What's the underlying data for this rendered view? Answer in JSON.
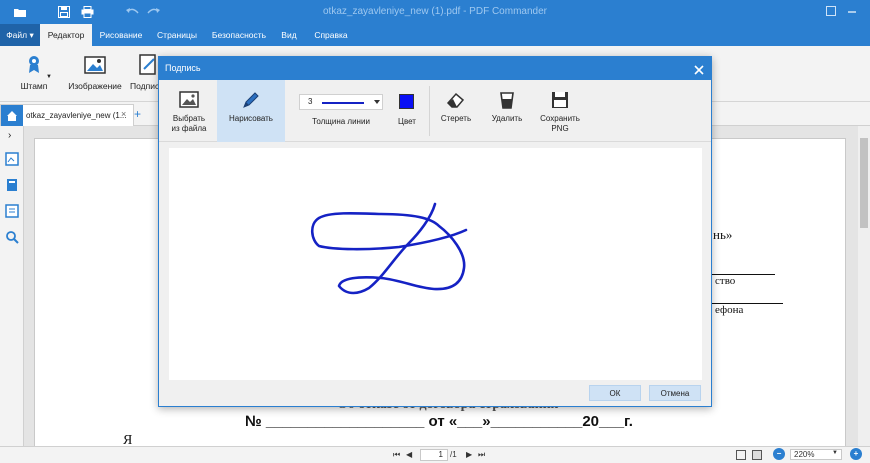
{
  "titlebar": {
    "title": "otkaz_zayavleniye_new (1).pdf - PDF Commander",
    "icons": [
      "folder-icon",
      "save-icon",
      "print-icon",
      "undo-icon",
      "redo-icon"
    ]
  },
  "tabs": {
    "file": "Файл",
    "items": [
      "Редактор",
      "Рисование",
      "Страницы",
      "Безопасность",
      "Вид",
      "Справка"
    ]
  },
  "ribbon": {
    "stamp": "Штамп",
    "image": "Изображение",
    "signature": "Подпис"
  },
  "doc": {
    "tab_name": "otkaz_zayavleniye_new (1...",
    "close": "×",
    "add": "+",
    "texts": {
      "quote_end": "нь»",
      "line1": "ство",
      "line2": "ефона",
      "heading_cut": "Об отказе от договора страхования",
      "number_line": "№ ___________________  от «___»___________20___г.",
      "ya": "Я"
    }
  },
  "dialog": {
    "title": "Подпись",
    "close": "✕",
    "tools": {
      "from_file": "Выбрать\nиз файла",
      "draw": "Нарисовать",
      "line_width_label": "Толщина линии",
      "line_width_value": "3",
      "color_label": "Цвет",
      "erase": "Стереть",
      "delete": "Удалить",
      "save_png": "Сохранить\nPNG"
    },
    "color": "#0a10f5",
    "ok": "ОК",
    "cancel": "Отмена"
  },
  "statusbar": {
    "page_current": "1",
    "page_total": "/1",
    "zoom": "220%"
  },
  "colors": {
    "accent": "#2b7fd0",
    "stroke": "#1522c4"
  }
}
